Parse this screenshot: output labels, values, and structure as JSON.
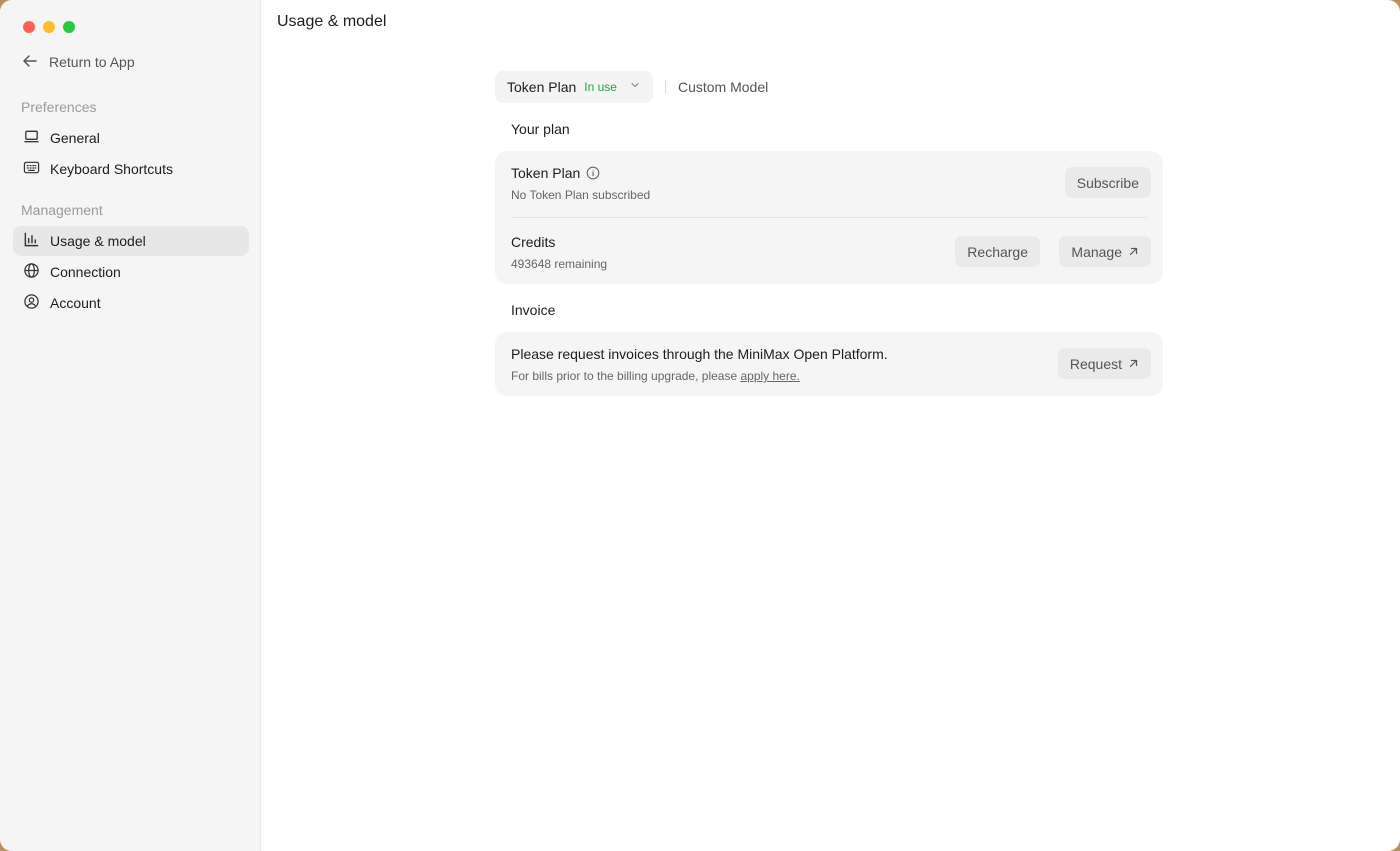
{
  "window": {
    "title": "Usage & model"
  },
  "sidebar": {
    "return_label": "Return to App",
    "sections": [
      {
        "label": "Preferences",
        "items": [
          {
            "label": "General",
            "icon": "laptop-icon"
          },
          {
            "label": "Keyboard Shortcuts",
            "icon": "keyboard-icon"
          }
        ]
      },
      {
        "label": "Management",
        "items": [
          {
            "label": "Usage & model",
            "icon": "bar-chart-icon",
            "active": true
          },
          {
            "label": "Connection",
            "icon": "globe-icon"
          },
          {
            "label": "Account",
            "icon": "user-circle-icon"
          }
        ]
      }
    ]
  },
  "tabs": {
    "plan_label": "Token Plan",
    "plan_badge": "In use",
    "custom_label": "Custom Model"
  },
  "plan": {
    "heading": "Your plan",
    "token_plan": {
      "title": "Token Plan",
      "subtitle": "No Token Plan subscribed",
      "button": "Subscribe"
    },
    "credits": {
      "title": "Credits",
      "subtitle": "493648 remaining",
      "recharge": "Recharge",
      "manage": "Manage"
    }
  },
  "invoice": {
    "heading": "Invoice",
    "title": "Please request invoices through the MiniMax Open Platform.",
    "subtitle_prefix": "For bills prior to the billing upgrade, please ",
    "subtitle_link": "apply here.",
    "button": "Request"
  },
  "colors": {
    "accent_green": "#22a447",
    "sidebar_bg": "#f5f5f5",
    "card_bg": "#f5f5f5"
  }
}
